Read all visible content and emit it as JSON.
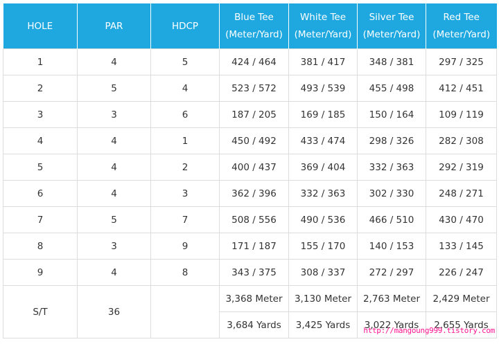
{
  "header": {
    "hole": "HOLE",
    "par": "PAR",
    "hdcp": "HDCP",
    "tees": [
      {
        "name": "Blue Tee",
        "unit": "(Meter/Yard)"
      },
      {
        "name": "White Tee",
        "unit": "(Meter/Yard)"
      },
      {
        "name": "Silver Tee",
        "unit": "(Meter/Yard)"
      },
      {
        "name": "Red Tee",
        "unit": "(Meter/Yard)"
      }
    ]
  },
  "rows": [
    {
      "hole": "1",
      "par": "4",
      "hdcp": "5",
      "blue": "424 / 464",
      "white": "381 / 417",
      "silver": "348 / 381",
      "red": "297 / 325"
    },
    {
      "hole": "2",
      "par": "5",
      "hdcp": "4",
      "blue": "523 / 572",
      "white": "493 / 539",
      "silver": "455 / 498",
      "red": "412 / 451"
    },
    {
      "hole": "3",
      "par": "3",
      "hdcp": "6",
      "blue": "187 / 205",
      "white": "169 / 185",
      "silver": "150 / 164",
      "red": "109 / 119"
    },
    {
      "hole": "4",
      "par": "4",
      "hdcp": "1",
      "blue": "450 / 492",
      "white": "433 / 474",
      "silver": "298 / 326",
      "red": "282 / 308"
    },
    {
      "hole": "5",
      "par": "4",
      "hdcp": "2",
      "blue": "400 / 437",
      "white": "369 / 404",
      "silver": "332 / 363",
      "red": "292 / 319"
    },
    {
      "hole": "6",
      "par": "4",
      "hdcp": "3",
      "blue": "362 / 396",
      "white": "332 / 363",
      "silver": "302 / 330",
      "red": "248 / 271"
    },
    {
      "hole": "7",
      "par": "5",
      "hdcp": "7",
      "blue": "508 / 556",
      "white": "490 / 536",
      "silver": "466 / 510",
      "red": "430 / 470"
    },
    {
      "hole": "8",
      "par": "3",
      "hdcp": "9",
      "blue": "171 / 187",
      "white": "155 / 170",
      "silver": "140 / 153",
      "red": "133 / 145"
    },
    {
      "hole": "9",
      "par": "4",
      "hdcp": "8",
      "blue": "343 / 375",
      "white": "308 / 337",
      "silver": "272 / 297",
      "red": "226 / 247"
    }
  ],
  "total": {
    "label": "S/T",
    "par": "36",
    "meters": {
      "blue": "3,368 Meter",
      "white": "3,130 Meter",
      "silver": "2,763 Meter",
      "red": "2,429 Meter"
    },
    "yards": {
      "blue": "3,684 Yards",
      "white": "3,425 Yards",
      "silver": "3,022 Yards",
      "red": "2,655 Yards"
    }
  },
  "watermark": "http://mangoung999.tistory.com",
  "colors": {
    "header_bg": "#1fa8e0",
    "header_text": "#ffffff",
    "grid": "#dcdcdc",
    "watermark": "#ff1493"
  }
}
